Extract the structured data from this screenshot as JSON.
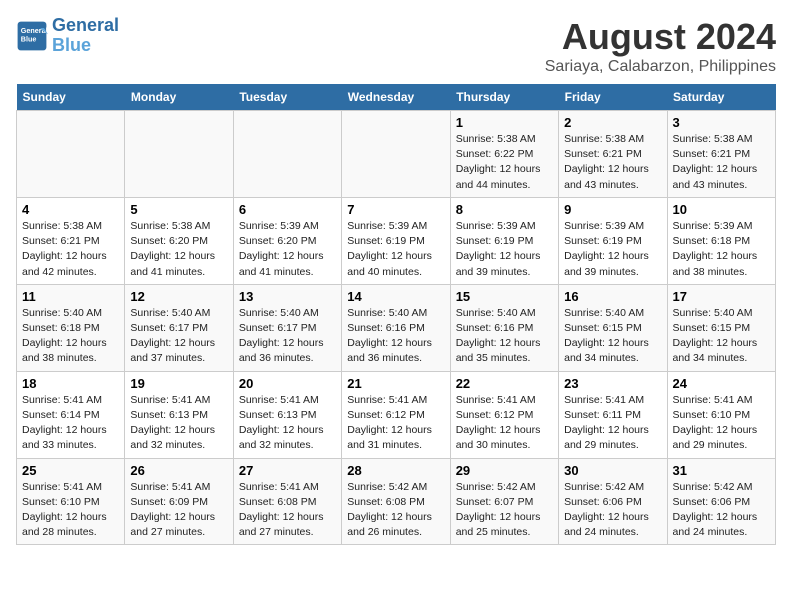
{
  "header": {
    "logo_line1": "General",
    "logo_line2": "Blue",
    "title": "August 2024",
    "subtitle": "Sariaya, Calabarzon, Philippines"
  },
  "days_of_week": [
    "Sunday",
    "Monday",
    "Tuesday",
    "Wednesday",
    "Thursday",
    "Friday",
    "Saturday"
  ],
  "weeks": [
    [
      {
        "day": "",
        "text": ""
      },
      {
        "day": "",
        "text": ""
      },
      {
        "day": "",
        "text": ""
      },
      {
        "day": "",
        "text": ""
      },
      {
        "day": "1",
        "text": "Sunrise: 5:38 AM\nSunset: 6:22 PM\nDaylight: 12 hours and 44 minutes."
      },
      {
        "day": "2",
        "text": "Sunrise: 5:38 AM\nSunset: 6:21 PM\nDaylight: 12 hours and 43 minutes."
      },
      {
        "day": "3",
        "text": "Sunrise: 5:38 AM\nSunset: 6:21 PM\nDaylight: 12 hours and 43 minutes."
      }
    ],
    [
      {
        "day": "4",
        "text": "Sunrise: 5:38 AM\nSunset: 6:21 PM\nDaylight: 12 hours and 42 minutes."
      },
      {
        "day": "5",
        "text": "Sunrise: 5:38 AM\nSunset: 6:20 PM\nDaylight: 12 hours and 41 minutes."
      },
      {
        "day": "6",
        "text": "Sunrise: 5:39 AM\nSunset: 6:20 PM\nDaylight: 12 hours and 41 minutes."
      },
      {
        "day": "7",
        "text": "Sunrise: 5:39 AM\nSunset: 6:19 PM\nDaylight: 12 hours and 40 minutes."
      },
      {
        "day": "8",
        "text": "Sunrise: 5:39 AM\nSunset: 6:19 PM\nDaylight: 12 hours and 39 minutes."
      },
      {
        "day": "9",
        "text": "Sunrise: 5:39 AM\nSunset: 6:19 PM\nDaylight: 12 hours and 39 minutes."
      },
      {
        "day": "10",
        "text": "Sunrise: 5:39 AM\nSunset: 6:18 PM\nDaylight: 12 hours and 38 minutes."
      }
    ],
    [
      {
        "day": "11",
        "text": "Sunrise: 5:40 AM\nSunset: 6:18 PM\nDaylight: 12 hours and 38 minutes."
      },
      {
        "day": "12",
        "text": "Sunrise: 5:40 AM\nSunset: 6:17 PM\nDaylight: 12 hours and 37 minutes."
      },
      {
        "day": "13",
        "text": "Sunrise: 5:40 AM\nSunset: 6:17 PM\nDaylight: 12 hours and 36 minutes."
      },
      {
        "day": "14",
        "text": "Sunrise: 5:40 AM\nSunset: 6:16 PM\nDaylight: 12 hours and 36 minutes."
      },
      {
        "day": "15",
        "text": "Sunrise: 5:40 AM\nSunset: 6:16 PM\nDaylight: 12 hours and 35 minutes."
      },
      {
        "day": "16",
        "text": "Sunrise: 5:40 AM\nSunset: 6:15 PM\nDaylight: 12 hours and 34 minutes."
      },
      {
        "day": "17",
        "text": "Sunrise: 5:40 AM\nSunset: 6:15 PM\nDaylight: 12 hours and 34 minutes."
      }
    ],
    [
      {
        "day": "18",
        "text": "Sunrise: 5:41 AM\nSunset: 6:14 PM\nDaylight: 12 hours and 33 minutes."
      },
      {
        "day": "19",
        "text": "Sunrise: 5:41 AM\nSunset: 6:13 PM\nDaylight: 12 hours and 32 minutes."
      },
      {
        "day": "20",
        "text": "Sunrise: 5:41 AM\nSunset: 6:13 PM\nDaylight: 12 hours and 32 minutes."
      },
      {
        "day": "21",
        "text": "Sunrise: 5:41 AM\nSunset: 6:12 PM\nDaylight: 12 hours and 31 minutes."
      },
      {
        "day": "22",
        "text": "Sunrise: 5:41 AM\nSunset: 6:12 PM\nDaylight: 12 hours and 30 minutes."
      },
      {
        "day": "23",
        "text": "Sunrise: 5:41 AM\nSunset: 6:11 PM\nDaylight: 12 hours and 29 minutes."
      },
      {
        "day": "24",
        "text": "Sunrise: 5:41 AM\nSunset: 6:10 PM\nDaylight: 12 hours and 29 minutes."
      }
    ],
    [
      {
        "day": "25",
        "text": "Sunrise: 5:41 AM\nSunset: 6:10 PM\nDaylight: 12 hours and 28 minutes."
      },
      {
        "day": "26",
        "text": "Sunrise: 5:41 AM\nSunset: 6:09 PM\nDaylight: 12 hours and 27 minutes."
      },
      {
        "day": "27",
        "text": "Sunrise: 5:41 AM\nSunset: 6:08 PM\nDaylight: 12 hours and 27 minutes."
      },
      {
        "day": "28",
        "text": "Sunrise: 5:42 AM\nSunset: 6:08 PM\nDaylight: 12 hours and 26 minutes."
      },
      {
        "day": "29",
        "text": "Sunrise: 5:42 AM\nSunset: 6:07 PM\nDaylight: 12 hours and 25 minutes."
      },
      {
        "day": "30",
        "text": "Sunrise: 5:42 AM\nSunset: 6:06 PM\nDaylight: 12 hours and 24 minutes."
      },
      {
        "day": "31",
        "text": "Sunrise: 5:42 AM\nSunset: 6:06 PM\nDaylight: 12 hours and 24 minutes."
      }
    ]
  ]
}
